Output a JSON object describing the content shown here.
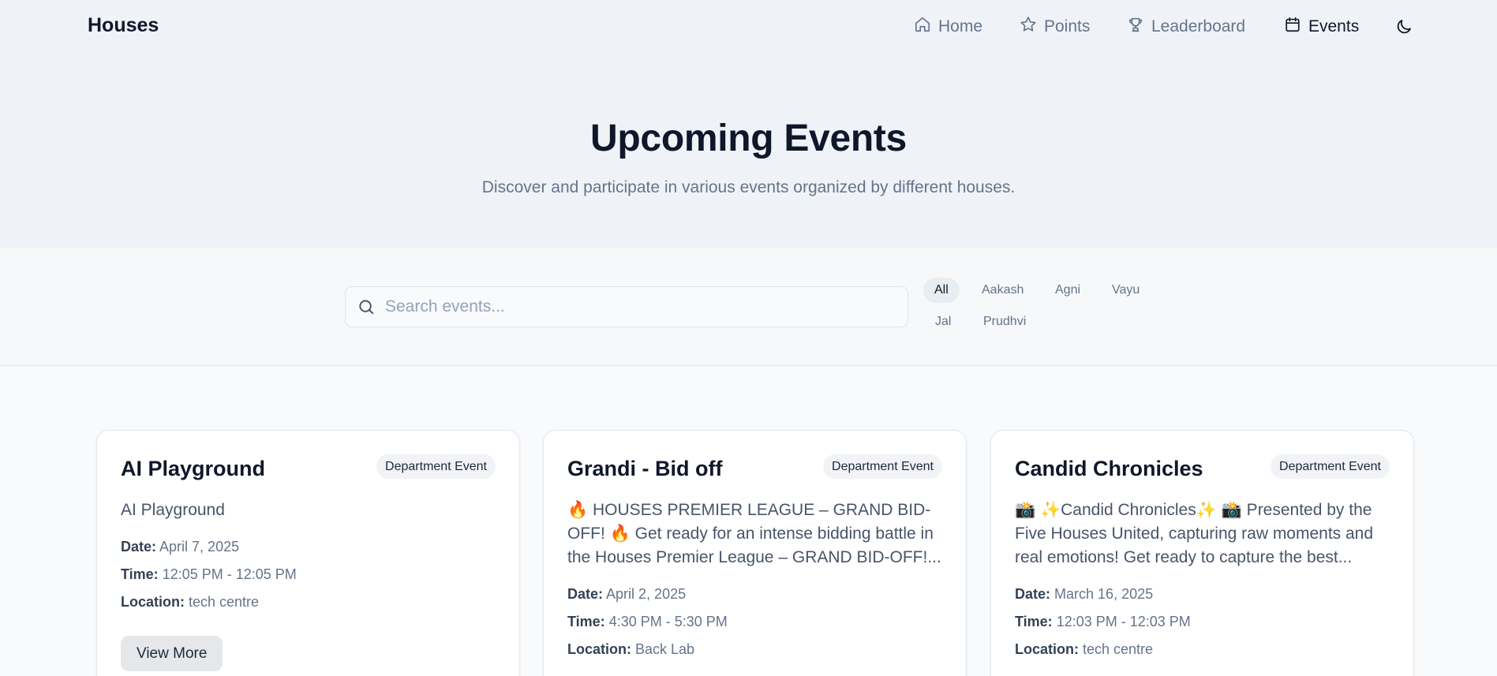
{
  "brand": "Houses",
  "nav": {
    "home": "Home",
    "points": "Points",
    "leaderboard": "Leaderboard",
    "events": "Events",
    "active": "Events"
  },
  "hero": {
    "title": "Upcoming Events",
    "subtitle": "Discover and participate in various events organized by different houses."
  },
  "search": {
    "placeholder": "Search events...",
    "value": ""
  },
  "filters": {
    "selected": "All",
    "items": [
      "All",
      "Aakash",
      "Agni",
      "Vayu",
      "Jal",
      "Prudhvi"
    ]
  },
  "labels": {
    "date": "Date:",
    "time": "Time:",
    "location": "Location:",
    "view_more": "View More"
  },
  "events": [
    {
      "title": "AI Playground",
      "badge": "Department Event",
      "description": "AI Playground",
      "date": "April 7, 2025",
      "time": "12:05 PM - 12:05 PM",
      "location": "tech centre"
    },
    {
      "title": "Grandi - Bid off",
      "badge": "Department Event",
      "description": "🔥 HOUSES PREMIER LEAGUE – GRAND BID-OFF! 🔥 Get ready for an intense bidding battle in the Houses Premier League – GRAND BID-OFF!...",
      "date": "April 2, 2025",
      "time": "4:30 PM - 5:30 PM",
      "location": "Back Lab"
    },
    {
      "title": "Candid Chronicles",
      "badge": "Department Event",
      "description": "📸 ✨Candid Chronicles✨ 📸 Presented by the Five Houses United, capturing raw moments and real emotions! Get ready to capture the best...",
      "date": "March 16, 2025",
      "time": "12:03 PM - 12:03 PM",
      "location": "tech centre"
    }
  ],
  "colors": {
    "header_bg": "#eff3f8",
    "text_primary": "#0f172a",
    "text_muted": "#64748b",
    "badge_bg": "#f1f3f6"
  }
}
